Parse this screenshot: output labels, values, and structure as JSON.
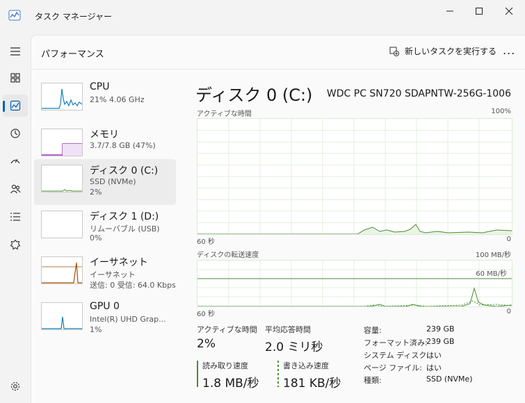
{
  "window": {
    "title": "タスク マネージャー"
  },
  "header": {
    "title": "パフォーマンス",
    "run_task": "新しいタスクを実行する",
    "more": "..."
  },
  "devices": [
    {
      "name": "CPU",
      "line1": "21%  4.06 GHz",
      "line2": ""
    },
    {
      "name": "メモリ",
      "line1": "3.7/7.8 GB (47%)",
      "line2": ""
    },
    {
      "name": "ディスク 0 (C:)",
      "line1": "SSD (NVMe)",
      "line2": "2%"
    },
    {
      "name": "ディスク 1 (D:)",
      "line1": "リムーバブル (USB)",
      "line2": "0%"
    },
    {
      "name": "イーサネット",
      "line1": "イーサネット",
      "line2": "送信: 0 受信: 64.0 Kbps"
    },
    {
      "name": "GPU 0",
      "line1": "Intel(R) UHD Grap...",
      "line2": "1%"
    }
  ],
  "detail": {
    "title": "ディスク 0 (C:)",
    "model": "WDC PC SN720 SDAPNTW-256G-1006",
    "chart1": {
      "label": "アクティブな時間",
      "max": "100%",
      "time": "60 秒",
      "min": "0"
    },
    "chart2": {
      "label": "ディスクの転送速度",
      "max": "100 MB/秒",
      "line": "60 MB/秒",
      "time": "60 秒",
      "min": "0"
    },
    "stats": {
      "active_label": "アクティブな時間",
      "active_value": "2%",
      "resp_label": "平均応答時間",
      "resp_value": "2.0 ミリ秒",
      "read_label": "読み取り速度",
      "read_value": "1.8 MB/秒",
      "write_label": "書き込み速度",
      "write_value": "181 KB/秒"
    },
    "props": [
      {
        "key": "容量:",
        "value": "239 GB"
      },
      {
        "key": "フォーマット済み:",
        "value": "239 GB"
      },
      {
        "key": "システム ディスク:",
        "value": "はい"
      },
      {
        "key": "ページ ファイル:",
        "value": "はい"
      },
      {
        "key": "種類:",
        "value": "SSD (NVMe)"
      }
    ]
  },
  "colors": {
    "accent": "#005fb8",
    "disk_green": "#4a8c32",
    "cpu_blue": "#117dbb",
    "memory_purple": "#8b12ae",
    "ethernet_orange": "#a74f01"
  }
}
